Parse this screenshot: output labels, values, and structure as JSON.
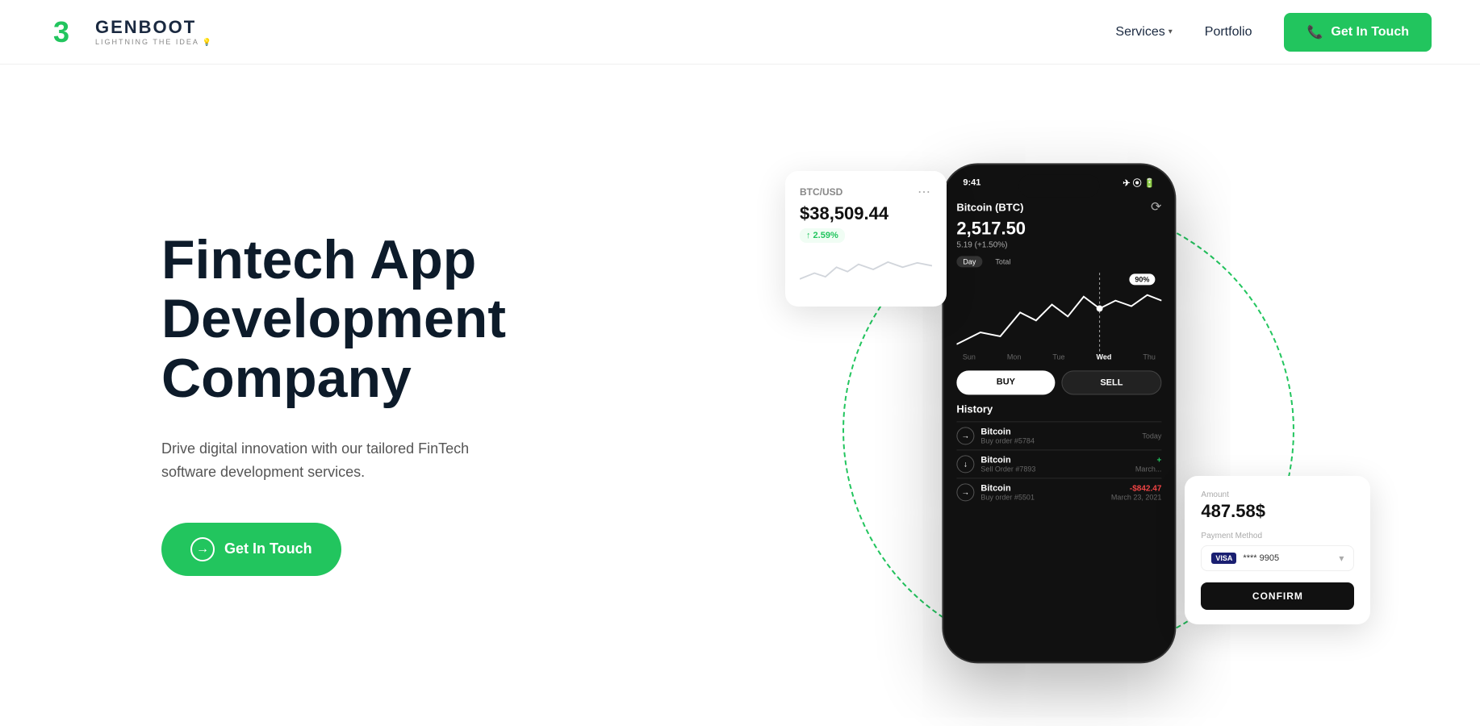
{
  "brand": {
    "logo_letter": "3",
    "name": "GENBOOT",
    "tagline": "LIGHTNING THE IDEA 💡"
  },
  "nav": {
    "services_label": "Services",
    "portfolio_label": "Portfolio",
    "cta_label": "Get In Touch"
  },
  "hero": {
    "title": "Fintech App Development Company",
    "desc": "Drive digital innovation with our tailored FinTech software development services.",
    "cta_label": "Get In Touch"
  },
  "phone": {
    "status_time": "9:41",
    "crypto_name": "Bitcoin (BTC)",
    "crypto_price": "2,517.50",
    "crypto_change": "5.19 (+1.50%)",
    "tab_day": "Day",
    "tab_total": "Total",
    "percent_badge": "90%",
    "days": [
      "Sun",
      "Mon",
      "Tue",
      "Wed",
      "Thu"
    ],
    "active_day": "Wed",
    "buy_label": "BUY",
    "sell_label": "SELL",
    "history_title": "History",
    "history_items": [
      {
        "coin": "Bitcoin",
        "order": "Buy order #5784",
        "date": "Today",
        "amount": ""
      },
      {
        "coin": "Bitcoin",
        "order": "Sell Order #7893",
        "date": "March...",
        "amount": "+"
      },
      {
        "coin": "Bitcoin",
        "order": "Buy order #5501",
        "date": "March 23, 2021",
        "amount": "-$842.47"
      }
    ]
  },
  "card_btcusd": {
    "label": "BTC/USD",
    "price": "$38,509.44",
    "change": "↑ 2.59%"
  },
  "card_payment": {
    "amount_label": "Amount",
    "amount": "487.58$",
    "method_label": "Payment Method",
    "visa_label": "VISA",
    "card_number": "**** 9905",
    "confirm_label": "CONFIRM"
  }
}
